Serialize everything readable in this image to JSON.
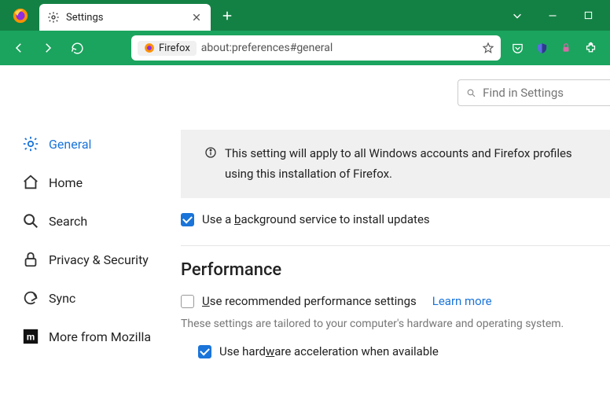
{
  "tab": {
    "title": "Settings"
  },
  "url": {
    "identity": "Firefox",
    "address": "about:preferences#general"
  },
  "search": {
    "placeholder": "Find in Settings"
  },
  "sidebar": {
    "items": [
      {
        "label": "General"
      },
      {
        "label": "Home"
      },
      {
        "label": "Search"
      },
      {
        "label": "Privacy & Security"
      },
      {
        "label": "Sync"
      },
      {
        "label": "More from Mozilla"
      }
    ]
  },
  "info_banner": "This setting will apply to all Windows accounts and Firefox profiles using this installation of Firefox.",
  "updates": {
    "bg_service": "Use a background service to install updates"
  },
  "performance": {
    "title": "Performance",
    "recommended": "Use recommended performance settings",
    "learn_more": "Learn more",
    "help": "These settings are tailored to your computer's hardware and operating system.",
    "hw_accel": "Use hardware acceleration when available"
  },
  "checkboxes": {
    "bg_service": true,
    "recommended": false,
    "hw_accel": true
  }
}
